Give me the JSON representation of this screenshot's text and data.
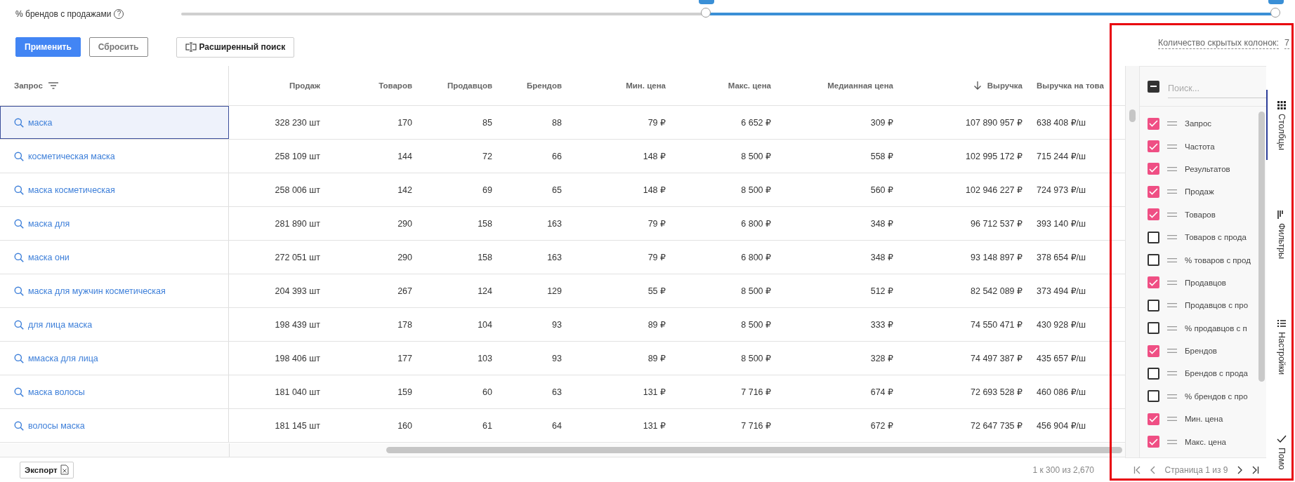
{
  "slider": {
    "label": "% брендов с продажами",
    "help": "?",
    "thumbs": [
      {
        "level": 0.48
      },
      {
        "level": 1
      }
    ]
  },
  "actions": {
    "buttons": [
      {
        "label": "Применить",
        "kind": "primary"
      },
      {
        "label": "Сбросить",
        "kind": "secondary"
      },
      {
        "label": "Расширенный поиск",
        "kind": "advanced"
      }
    ],
    "hidden_columns": {
      "label": "Количество скрытых колонок:",
      "count": "7"
    }
  },
  "table": {
    "columns": [
      {
        "label": "Запрос",
        "kind": "query",
        "filter": true
      },
      {
        "label": "Продаж",
        "kind": "num"
      },
      {
        "label": "Товаров",
        "kind": "num"
      },
      {
        "label": "Продавцов",
        "kind": "num"
      },
      {
        "label": "Брендов",
        "kind": "num"
      },
      {
        "label": "Мин. цена",
        "kind": "num"
      },
      {
        "label": "Макс. цена",
        "kind": "num"
      },
      {
        "label": "Медианная цена",
        "kind": "num"
      },
      {
        "label": "Выручка",
        "kind": "num",
        "sorted_descending": true
      },
      {
        "label": "Выручка на това",
        "kind": "cut"
      }
    ],
    "rows": [
      {
        "selected": true,
        "cells": [
          "маска",
          "328 230 шт",
          "170",
          "85",
          "88",
          "79 ₽",
          "6 652 ₽",
          "309 ₽",
          "107 890 957 ₽",
          "638 408 ₽/ш"
        ]
      },
      {
        "selected": false,
        "cells": [
          "косметическая маска",
          "258 109 шт",
          "144",
          "72",
          "66",
          "148 ₽",
          "8 500 ₽",
          "558 ₽",
          "102 995 172 ₽",
          "715 244 ₽/ш"
        ]
      },
      {
        "selected": false,
        "cells": [
          "маска косметическая",
          "258 006 шт",
          "142",
          "69",
          "65",
          "148 ₽",
          "8 500 ₽",
          "560 ₽",
          "102 946 227 ₽",
          "724 973 ₽/ш"
        ]
      },
      {
        "selected": false,
        "cells": [
          "маска для",
          "281 890 шт",
          "290",
          "158",
          "163",
          "79 ₽",
          "6 800 ₽",
          "348 ₽",
          "96 712 537 ₽",
          "393 140 ₽/ш"
        ]
      },
      {
        "selected": false,
        "cells": [
          "маска они",
          "272 051 шт",
          "290",
          "158",
          "163",
          "79 ₽",
          "6 800 ₽",
          "348 ₽",
          "93 148 897 ₽",
          "378 654 ₽/ш"
        ]
      },
      {
        "selected": false,
        "cells": [
          "маска для мужчин косметическая",
          "204 393 шт",
          "267",
          "124",
          "129",
          "55 ₽",
          "8 500 ₽",
          "512 ₽",
          "82 542 089 ₽",
          "373 494 ₽/ш"
        ]
      },
      {
        "selected": false,
        "cells": [
          "для лица маска",
          "198 439 шт",
          "178",
          "104",
          "93",
          "89 ₽",
          "8 500 ₽",
          "333 ₽",
          "74 550 471 ₽",
          "430 928 ₽/ш"
        ]
      },
      {
        "selected": false,
        "cells": [
          "ммаска для лица",
          "198 406 шт",
          "177",
          "103",
          "93",
          "89 ₽",
          "8 500 ₽",
          "328 ₽",
          "74 497 387 ₽",
          "435 657 ₽/ш"
        ]
      },
      {
        "selected": false,
        "cells": [
          "маска волосы",
          "181 040 шт",
          "159",
          "60",
          "63",
          "131 ₽",
          "7 716 ₽",
          "674 ₽",
          "72 693 528 ₽",
          "460 086 ₽/ш"
        ]
      },
      {
        "selected": false,
        "cells": [
          "волосы маска",
          "181 145 шт",
          "160",
          "61",
          "64",
          "131 ₽",
          "7 716 ₽",
          "672 ₽",
          "72 647 735 ₽",
          "456 904 ₽/ш"
        ]
      }
    ]
  },
  "panel": {
    "select_all": {
      "indeterminate": true
    },
    "search": {
      "placeholder": "Поиск..."
    },
    "columns": [
      {
        "label": "Запрос",
        "checked": true
      },
      {
        "label": "Частота",
        "checked": true
      },
      {
        "label": "Результатов",
        "checked": true
      },
      {
        "label": "Продаж",
        "checked": true
      },
      {
        "label": "Товаров",
        "checked": true
      },
      {
        "label": "Товаров с прода",
        "checked": false
      },
      {
        "label": "% товаров с прод",
        "checked": false
      },
      {
        "label": "Продавцов",
        "checked": true
      },
      {
        "label": "Продавцов с про",
        "checked": false
      },
      {
        "label": "% продавцов с п",
        "checked": false
      },
      {
        "label": "Брендов",
        "checked": true
      },
      {
        "label": "Брендов с прода",
        "checked": false
      },
      {
        "label": "% брендов с про",
        "checked": false
      },
      {
        "label": "Мин. цена",
        "checked": true
      },
      {
        "label": "Макс. цена",
        "checked": true
      }
    ],
    "pagination": {
      "text": "Страница 1 из 9"
    }
  },
  "side_tabs": [
    {
      "label": "Столбцы",
      "kind": "columns",
      "selected": true
    },
    {
      "label": "Фильтры",
      "kind": "filters",
      "selected": false
    },
    {
      "label": "Настройки",
      "kind": "settings",
      "selected": false
    },
    {
      "label": "Помо",
      "kind": "help",
      "selected": false
    }
  ],
  "footer": {
    "export": "Экспорт",
    "range": "1 к 300 из 2,670"
  }
}
